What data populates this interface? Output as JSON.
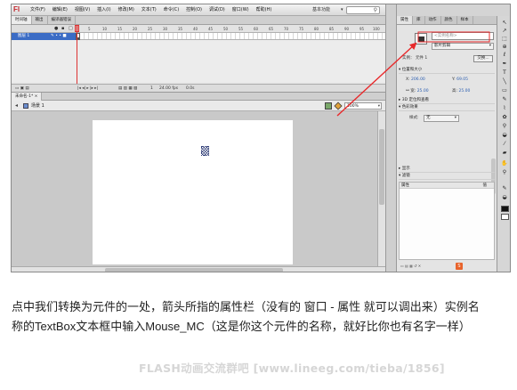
{
  "app": {
    "logo": "Fl"
  },
  "menubar": {
    "items": [
      "文件(F)",
      "编辑(E)",
      "视图(V)",
      "插入(I)",
      "修改(M)",
      "文本(T)",
      "命令(C)",
      "控制(O)",
      "调试(D)",
      "窗口(W)",
      "帮助(H)"
    ],
    "workspace": "基本功能"
  },
  "timeline": {
    "tabs": [
      "时间轴",
      "输出",
      "编译器错误"
    ],
    "header_icons": [
      "eye-icon",
      "lock-icon",
      "outline-icon"
    ],
    "ruler": [
      "5",
      "10",
      "15",
      "20",
      "25",
      "30",
      "35",
      "40",
      "45",
      "50",
      "55",
      "60",
      "65",
      "70",
      "75",
      "80",
      "85",
      "90",
      "95",
      "100"
    ],
    "layer_name": "图层 1",
    "status": {
      "frame": "1",
      "fps": "24.00 fps",
      "time": "0.0s"
    }
  },
  "document": {
    "tab_label": "未命名-1* ×",
    "scene_label": "场景 1",
    "zoom": "100%"
  },
  "properties": {
    "tabs": [
      "属性",
      "库",
      "动作",
      "颜色",
      "样本"
    ],
    "instance_name_placeholder": "<实例名称>",
    "symbol_type": "影片剪辑",
    "instance_of_label": "实例：",
    "instance_of_value": "元件 1",
    "swap_label": "交换...",
    "sections": {
      "position": "位置和大小",
      "three_d": "3D 定位和查看",
      "color_effect": "色彩效果",
      "display": "显示",
      "filters": "滤镜"
    },
    "x_label": "X:",
    "x_value": "206.00",
    "y_label": "Y:",
    "y_value": "69.05",
    "w_label": "宽:",
    "w_value": "25.00",
    "h_label": "高:",
    "h_value": "25.00",
    "style_label": "样式:",
    "style_value": "无",
    "library_col_name": "属性",
    "library_col_value": "值"
  },
  "tools": [
    "selection-tool-icon",
    "subselection-tool-icon",
    "free-transform-icon",
    "lasso-icon",
    "pen-icon",
    "text-tool-icon",
    "line-tool-icon",
    "rectangle-tool-icon",
    "pencil-icon",
    "brush-icon",
    "deco-icon",
    "bone-icon",
    "paint-bucket-icon",
    "eyedropper-icon",
    "eraser-icon",
    "hand-icon",
    "zoom-icon"
  ],
  "caption": {
    "line1": "点中我们转换为元件的一处，箭头所指的属性栏（没有的 窗口 - 属性 就可以调出来）实例名",
    "line2": "称的TextBox文本框中输入Mouse_MC（这是你这个元件的名称，就好比你也有名字一样）"
  },
  "watermark": "FLASH动画交流群吧  [www.lineeg.com/tieba/1856]",
  "colors": {
    "annotation_arrow": "#e8282a",
    "layer_selected": "#3b6cc5",
    "playhead": "#dd3333"
  }
}
